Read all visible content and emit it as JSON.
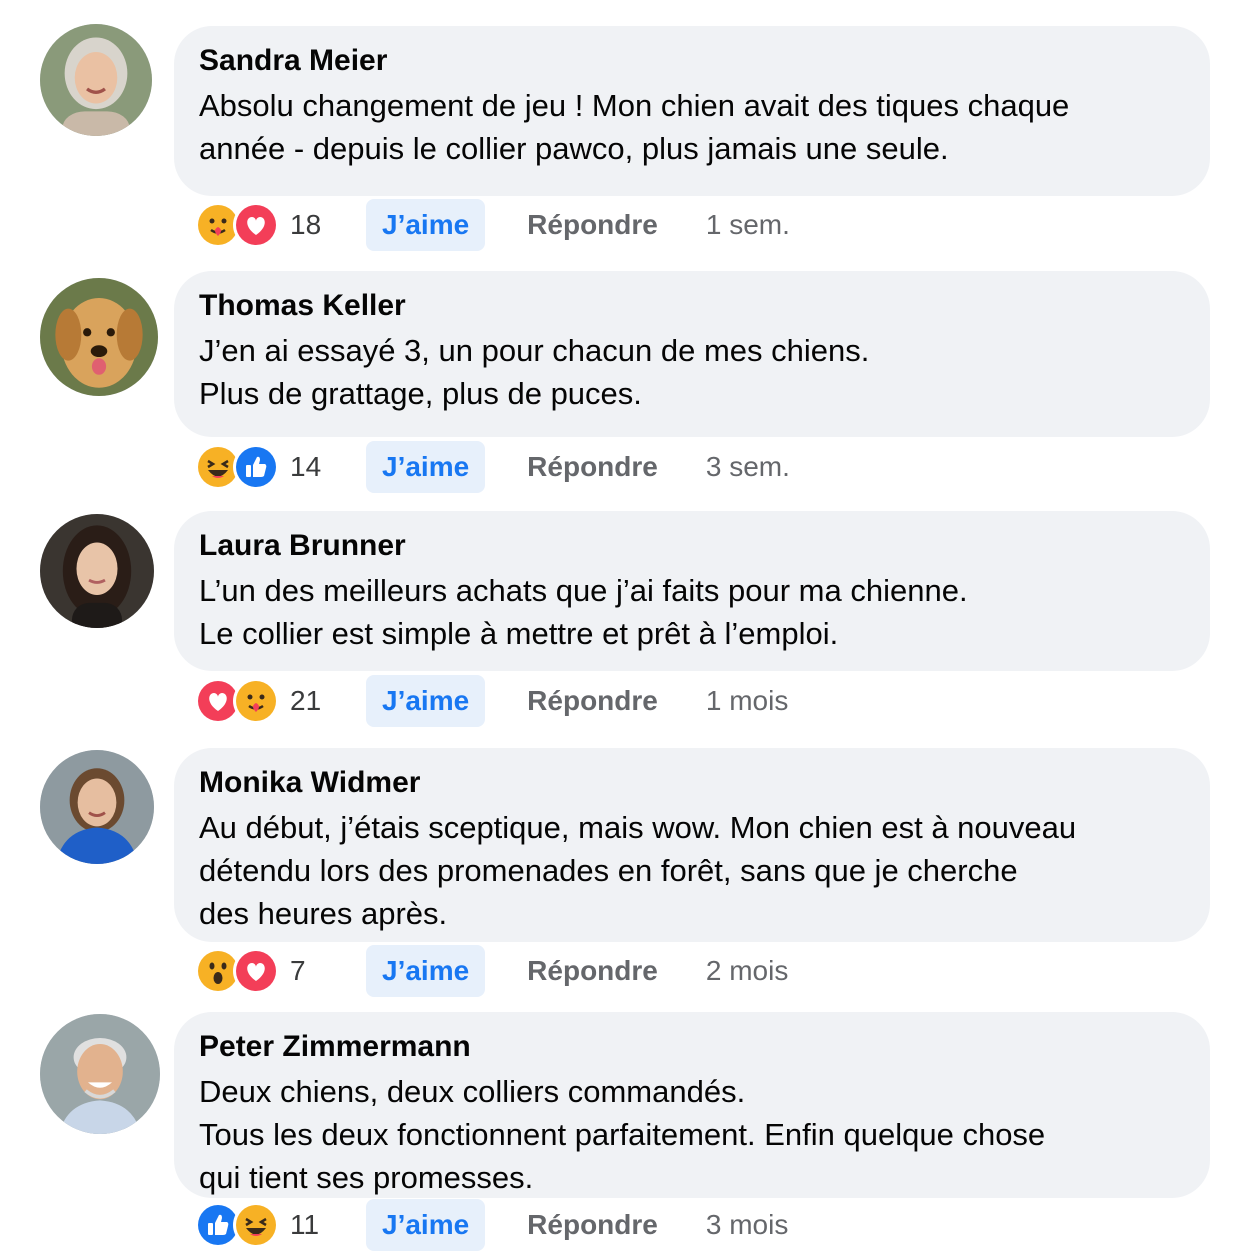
{
  "comments": [
    {
      "author": "Sandra Meier",
      "lines": [
        "Absolu changement de jeu ! Mon chien avait des tiques chaque",
        "année - depuis le collier pawco, plus jamais une seule."
      ],
      "reactions": [
        "hug",
        "love"
      ],
      "count": "18",
      "like_label": "J’aime",
      "reply_label": "Répondre",
      "time": "1 sem."
    },
    {
      "author": "Thomas Keller",
      "lines": [
        "J’en ai essayé 3, un pour chacun de mes chiens.",
        "Plus de grattage, plus de puces."
      ],
      "reactions": [
        "haha",
        "like"
      ],
      "count": "14",
      "like_label": "J’aime",
      "reply_label": "Répondre",
      "time": "3 sem."
    },
    {
      "author": "Laura Brunner",
      "lines": [
        "L’un des meilleurs achats que j’ai faits pour ma chienne.",
        "Le collier est simple à mettre et prêt à l’emploi."
      ],
      "reactions": [
        "love",
        "hug"
      ],
      "count": "21",
      "like_label": "J’aime",
      "reply_label": "Répondre",
      "time": "1 mois"
    },
    {
      "author": "Monika Widmer",
      "lines": [
        "Au début, j’étais sceptique, mais wow. Mon chien est à nouveau",
        "détendu lors des promenades en forêt, sans que je cherche",
        "des heures après."
      ],
      "reactions": [
        "wow",
        "love"
      ],
      "count": "7",
      "like_label": "J’aime",
      "reply_label": "Répondre",
      "time": "2 mois"
    },
    {
      "author": "Peter Zimmermann",
      "lines": [
        "Deux chiens, deux colliers commandés.",
        "Tous les deux fonctionnent parfaitement. Enfin quelque chose",
        "qui tient ses promesses."
      ],
      "reactions": [
        "like",
        "haha"
      ],
      "count": "11",
      "like_label": "J’aime",
      "reply_label": "Répondre",
      "time": "3 mois"
    }
  ],
  "colors": {
    "like_blue": "#1877f2",
    "love_red": "#f33e58",
    "reaction_yellow": "#f7b125",
    "bubble_bg": "#f0f2f5"
  }
}
